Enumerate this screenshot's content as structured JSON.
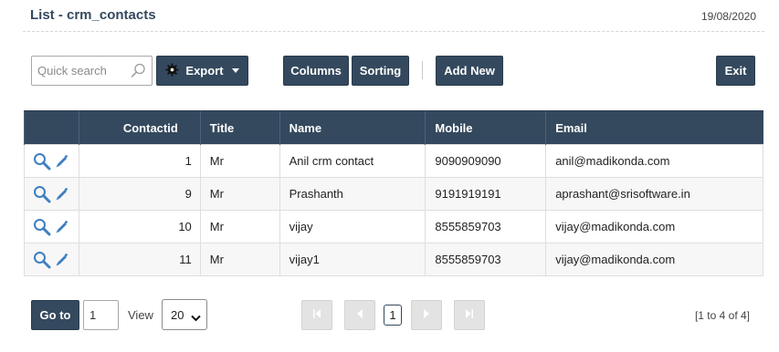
{
  "page": {
    "title": "List - crm_contacts",
    "date": "19/08/2020"
  },
  "toolbar": {
    "search_placeholder": "Quick search",
    "export_label": "Export",
    "columns_label": "Columns",
    "sorting_label": "Sorting",
    "add_new_label": "Add New",
    "exit_label": "Exit"
  },
  "table": {
    "headers": {
      "contactid": "Contactid",
      "title": "Title",
      "name": "Name",
      "mobile": "Mobile",
      "email": "Email"
    },
    "rows": [
      {
        "contactid": "1",
        "title": "Mr",
        "name": "Anil crm contact",
        "mobile": "9090909090",
        "email": "anil@madikonda.com"
      },
      {
        "contactid": "9",
        "title": "Mr",
        "name": "Prashanth",
        "mobile": "9191919191",
        "email": "aprashant@srisoftware.in"
      },
      {
        "contactid": "10",
        "title": "Mr",
        "name": "vijay",
        "mobile": "8555859703",
        "email": "vijay@madikonda.com"
      },
      {
        "contactid": "11",
        "title": "Mr",
        "name": "vijay1",
        "mobile": "8555859703",
        "email": "vijay@madikonda.com"
      }
    ],
    "row_icons": [
      "search-icon",
      "edit-pencil-icon"
    ]
  },
  "pager": {
    "goto_label": "Go to",
    "goto_value": "1",
    "view_label": "View",
    "page_size": "20",
    "current_page": "1",
    "range_text": "[1 to 4 of 4]"
  },
  "colors": {
    "primary": "#34495e",
    "icon": "#3d7fc1",
    "disabled": "#e3e3e3"
  }
}
